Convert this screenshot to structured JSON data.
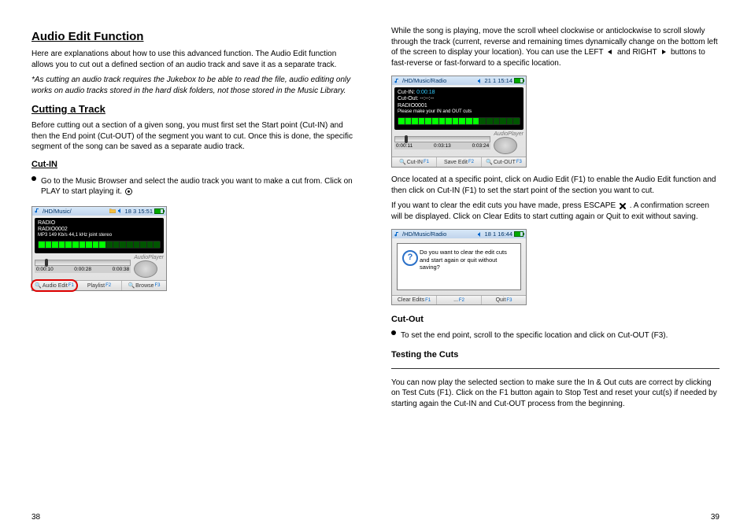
{
  "page_left_num": "38",
  "page_right_num": "39",
  "left": {
    "h1": "Audio Edit Function",
    "p1": "Here are explanations about how to use this advanced function. The Audio Edit function allows you to cut out a defined section of an audio track and save it as a separate track.",
    "note_star": "*As cutting an audio track requires the Jukebox to be able to read the file, audio editing only works on audio tracks stored in the hard disk folders, not those stored in the Music Library.",
    "h2": "Cutting a Track",
    "p2": "Before cutting out a section of a given song, you must first set the Start point (Cut-IN) and then the End point (Cut-OUT) of the segment you want to cut. Once this is done, the specific segment of the song can be saved as a separate audio track.",
    "h3": "Cut-IN",
    "bullet1": "Go to the Music Browser and select the audio track you want to make a cut from. Click on PLAY  to start playing it.",
    "player1": {
      "path": "/HD/Music/",
      "status_right": "18 3 15:51",
      "lcd_line1": "RADIO",
      "lcd_line2": "RADIO0002",
      "lcd_line3": "MP3 149 Kb/s 44,1 kHz joint stereo",
      "times": [
        "0:00:10",
        "0:00:28",
        "0:00:38"
      ],
      "btn1": "Audio Edit",
      "btn2": "Playlist",
      "btn3": "Browse"
    }
  },
  "right": {
    "top_para_a": "While the song is playing, move the scroll wheel clockwise or anticlockwise to scroll slowly through the track (current, reverse and remaining times dynamically change on the bottom left of the screen to display your location). You can use the LEFT ",
    "top_para_b": " and RIGHT ",
    "top_para_c": " buttons to fast-reverse or fast-forward to a specific location.",
    "player2": {
      "path": "/HD/Music/Radio",
      "status_right": "21 1 15:14",
      "cutin_label": "Cut-IN:",
      "cutin_val": "0:00:18",
      "cutout_label": "Cut-Out:",
      "cutout_val": "--:--:--",
      "file": "RADIO0001",
      "msg": "Please make your IN and OUT cuts",
      "times": [
        "0:00:11",
        "0:03:13",
        "0:03:24"
      ],
      "btn1": "Cut-IN",
      "btn2": "Save Edit",
      "btn3": "Cut-OUT"
    },
    "p_after_player2": "Once located at a specific point, click on Audio Edit (F1) to enable the Audio Edit function and then click on Cut-IN (F1) to set the start point of the section you want to cut.",
    "clear_para_a": "If you want to clear the edit cuts you have made, press ESCAPE  ",
    "clear_para_b": ". A confirmation screen will be displayed. Click on Clear Edits to start cutting again or Quit to exit without saving.",
    "player3": {
      "path": "/HD/Music/Radio",
      "status_right": "18 1 16:44",
      "dialog": "Do you want to clear the edit cuts and start again or quit without saving?",
      "btn1": "Clear Edits",
      "btn2": "...",
      "btn3": "Quit"
    },
    "h4": "Cut-Out",
    "cutout_bullet": "To set the end point, scroll to the specific location and click on Cut-OUT (F3).",
    "h4b": "Testing the Cuts",
    "test_para": "You can now play the selected section to make sure the In & Out cuts are correct by clicking on Test Cuts (F1). Click on the F1 button again to Stop Test and reset your cut(s) if needed by starting again the Cut-IN and Cut-OUT process from the beginning."
  }
}
